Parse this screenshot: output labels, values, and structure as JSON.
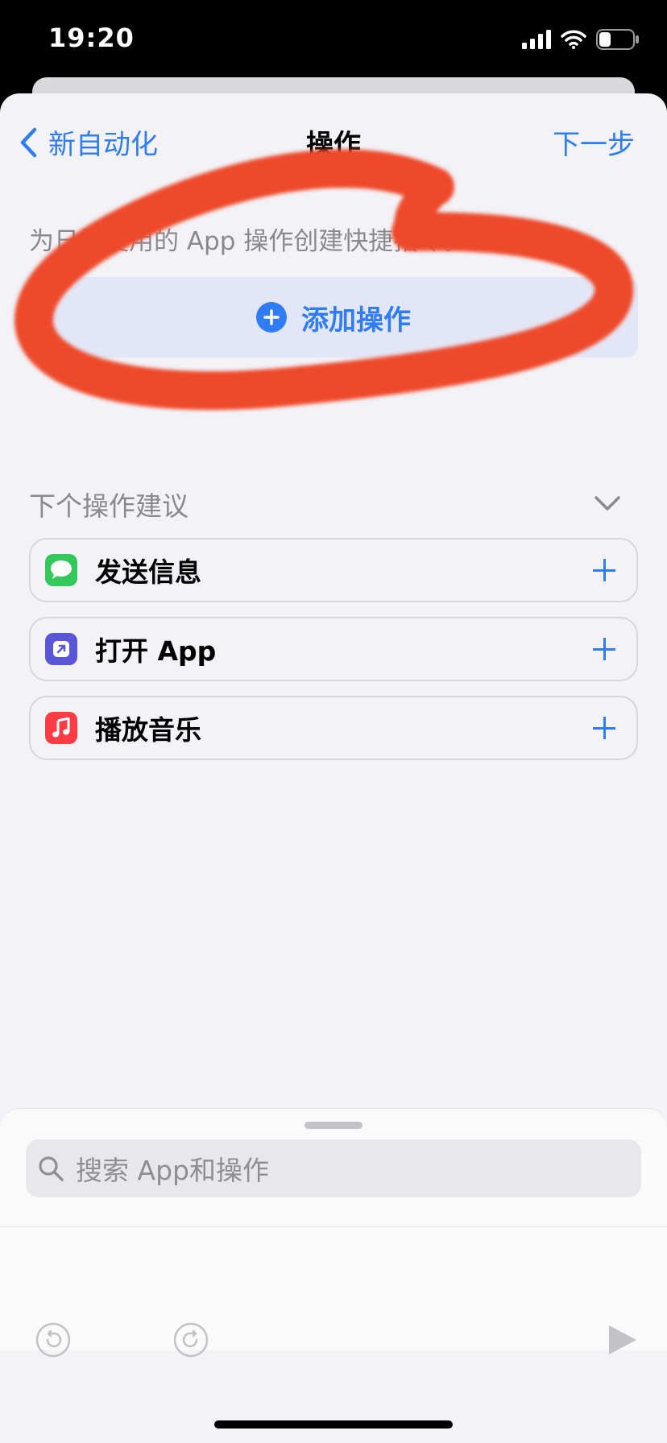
{
  "status_bar": {
    "time": "19:20",
    "battery_level": 0.35
  },
  "nav": {
    "back_label": "新自动化",
    "title": "操作",
    "next_label": "下一步"
  },
  "description": "为日常使用的 App 操作创建快捷指令。",
  "add_action_label": "添加操作",
  "suggestions_header": "下个操作建议",
  "suggestions": [
    {
      "label": "发送信息",
      "icon": "messages-icon",
      "color": "#34c759"
    },
    {
      "label": "打开 App",
      "icon": "open-app-icon",
      "color": "#5856d6"
    },
    {
      "label": "播放音乐",
      "icon": "music-icon",
      "color": "#fc3c44"
    }
  ],
  "search": {
    "placeholder": "搜索 App和操作"
  },
  "toolbar": {
    "icons": [
      "undo-icon",
      "redo-icon",
      "play-icon"
    ]
  },
  "colors": {
    "accent": "#2f7cf6",
    "annotation": "#ee4a2a",
    "background": "#f2f2f7"
  }
}
